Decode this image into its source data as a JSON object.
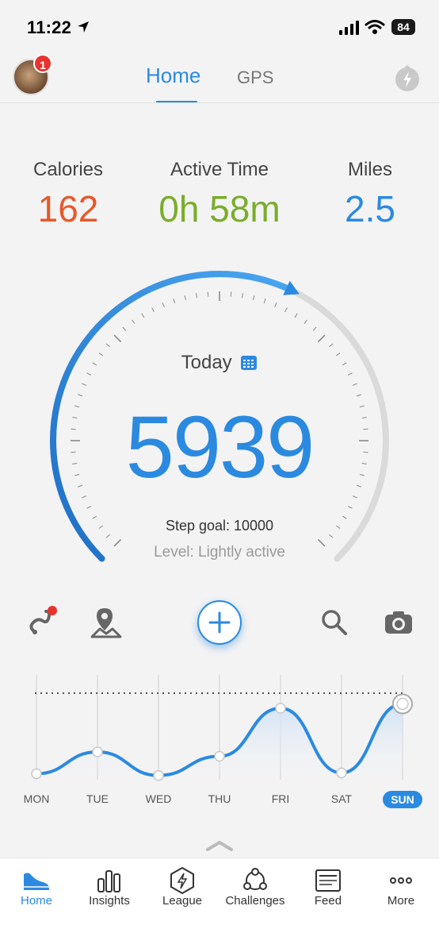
{
  "status_bar": {
    "time": "11:22",
    "battery": "84"
  },
  "header": {
    "notification_count": "1",
    "tabs": [
      "Home",
      "GPS"
    ]
  },
  "stats": [
    {
      "label": "Calories",
      "value": "162",
      "color": "#e8582a"
    },
    {
      "label": "Active Time",
      "value": "0h 58m",
      "color": "#7aad2a"
    },
    {
      "label": "Miles",
      "value": "2.5",
      "color": "#2b8ae0"
    }
  ],
  "gauge": {
    "today_label": "Today",
    "steps": "5939",
    "goal_text": "Step goal: 10000",
    "level_text": "Level: Lightly active",
    "progress": 0.5939
  },
  "toolbar": {
    "icons": [
      "route-icon",
      "map-pin-icon",
      "add-icon",
      "search-icon",
      "camera-icon"
    ]
  },
  "week_chart": {
    "days": [
      "MON",
      "TUE",
      "WED",
      "THU",
      "FRI",
      "SAT",
      "SUN"
    ],
    "active_day": "SUN",
    "relative_values": [
      0.05,
      0.3,
      0.03,
      0.25,
      0.8,
      0.06,
      0.85
    ]
  },
  "bottom_nav": [
    {
      "label": "Home",
      "icon": "shoe-icon"
    },
    {
      "label": "Insights",
      "icon": "bar-chart-icon"
    },
    {
      "label": "League",
      "icon": "league-icon"
    },
    {
      "label": "Challenges",
      "icon": "challenges-icon"
    },
    {
      "label": "Feed",
      "icon": "feed-icon"
    },
    {
      "label": "More",
      "icon": "more-icon"
    }
  ]
}
